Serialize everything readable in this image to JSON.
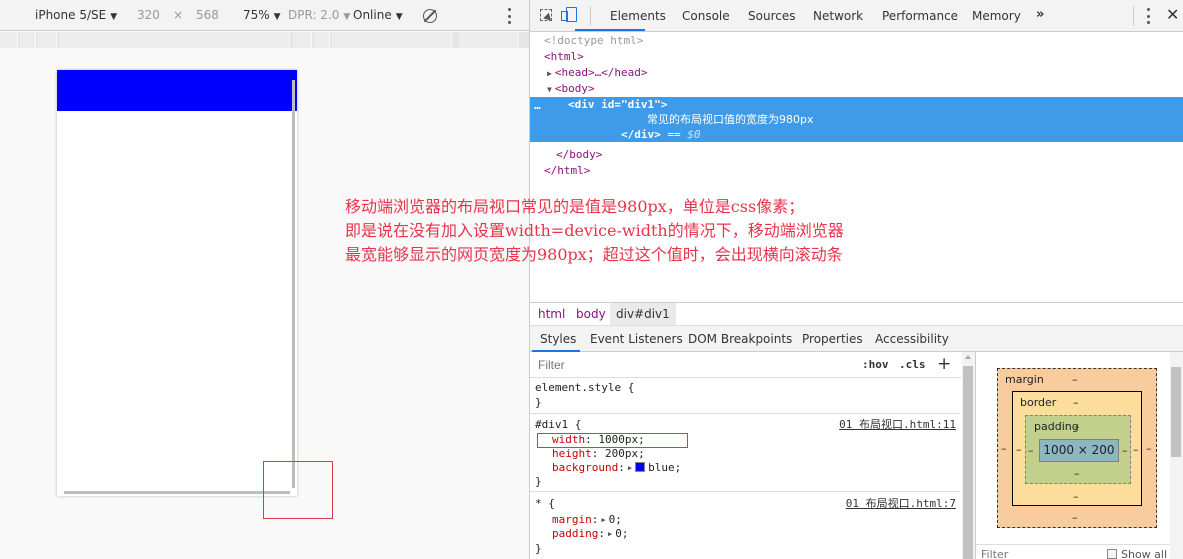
{
  "device_toolbar": {
    "device": "iPhone 5/SE",
    "width": "320",
    "times": "×",
    "height": "568",
    "zoom": "75%",
    "dpr": "DPR: 2.0",
    "network": "Online",
    "caret": "▼",
    "rotate_icon": "rotate-icon",
    "more_icon": "kebab-icon"
  },
  "emulated_page": {
    "div_background": "#0000ff"
  },
  "devtools": {
    "tabs": [
      "Elements",
      "Console",
      "Sources",
      "Network",
      "Performance",
      "Memory"
    ],
    "active_tab": "Elements",
    "more_tabs": "»",
    "close": "✕"
  },
  "dom_tree": {
    "doctype": "<!doctype html>",
    "html_open": "<html>",
    "head": "<head>…</head>",
    "body_open": "<body>",
    "selected_dots": "…",
    "div_open": "<div id=\"div1\">",
    "div_text": "常见的布局视口值的宽度为980px",
    "div_close": "</div>",
    "div_eq": " == ",
    "div_dollar": "$0",
    "body_close": "</body>",
    "html_close": "</html>"
  },
  "annotation": {
    "lines": [
      "移动端浏览器的布局视口常见的是值是980px，单位是css像素；",
      "即是说在没有加入设置width=device-width的情况下，移动端浏览器",
      "最宽能够显示的网页宽度为980px；超过这个值时，会出现横向滚动条"
    ],
    "color": "#e8344a"
  },
  "breadcrumbs": [
    "html",
    "body",
    "div#div1"
  ],
  "sidebar_tabs": [
    "Styles",
    "Event Listeners",
    "DOM Breakpoints",
    "Properties",
    "Accessibility"
  ],
  "styles": {
    "filter_placeholder": "Filter",
    "hov": ":hov",
    "cls": ".cls",
    "add": "+",
    "element_style": {
      "selector": "element.style {",
      "close": "}"
    },
    "div1_rule": {
      "selector": "#div1 {",
      "source": "01 布局视口.html:11",
      "props": [
        {
          "name": "width",
          "value": "1000px;"
        },
        {
          "name": "height",
          "value": "200px;"
        },
        {
          "name": "background",
          "value": "blue;"
        }
      ],
      "close": "}"
    },
    "universal_rule": {
      "selector": "* {",
      "source": "01 布局视口.html:7",
      "props": [
        {
          "name": "margin",
          "value": "0;"
        },
        {
          "name": "padding",
          "value": "0;"
        }
      ],
      "close": "}"
    },
    "colon": ":"
  },
  "box_model": {
    "margin_label": "margin",
    "border_label": "border",
    "padding_label": "padding",
    "content": "1000 × 200",
    "dash": "–",
    "filter": "Filter",
    "show_all": "Show all"
  }
}
